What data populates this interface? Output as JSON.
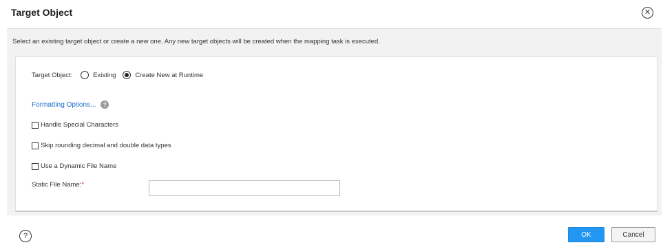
{
  "dialog": {
    "title": "Target Object",
    "close_symbol": "✕",
    "description": "Select an existing target object or create a new one. Any new target objects will be created when the mapping task is executed."
  },
  "target_object": {
    "label": "Target Object:",
    "options": [
      "Existing",
      "Create New at Runtime"
    ],
    "selected": "Create New at Runtime"
  },
  "formatting": {
    "link_label": "Formatting Options...",
    "help_symbol": "?"
  },
  "checkboxes": [
    {
      "label": "Handle Special Characters",
      "checked": false
    },
    {
      "label": "Skip rounding decimal and double data types",
      "checked": false
    },
    {
      "label": "Use a Dynamic File Name",
      "checked": false
    }
  ],
  "static_file_name": {
    "label": "Static File Name:",
    "required_marker": "*",
    "value": "",
    "placeholder": ""
  },
  "footer": {
    "help_symbol": "?",
    "ok_label": "OK",
    "cancel_label": "Cancel"
  },
  "colors": {
    "accent": "#2196f3",
    "link": "#1a6ec8",
    "required": "#d02020",
    "panel_bg": "#f2f2f2"
  },
  "icons": {
    "close": "close-icon",
    "help": "help-icon",
    "info": "info-icon"
  }
}
